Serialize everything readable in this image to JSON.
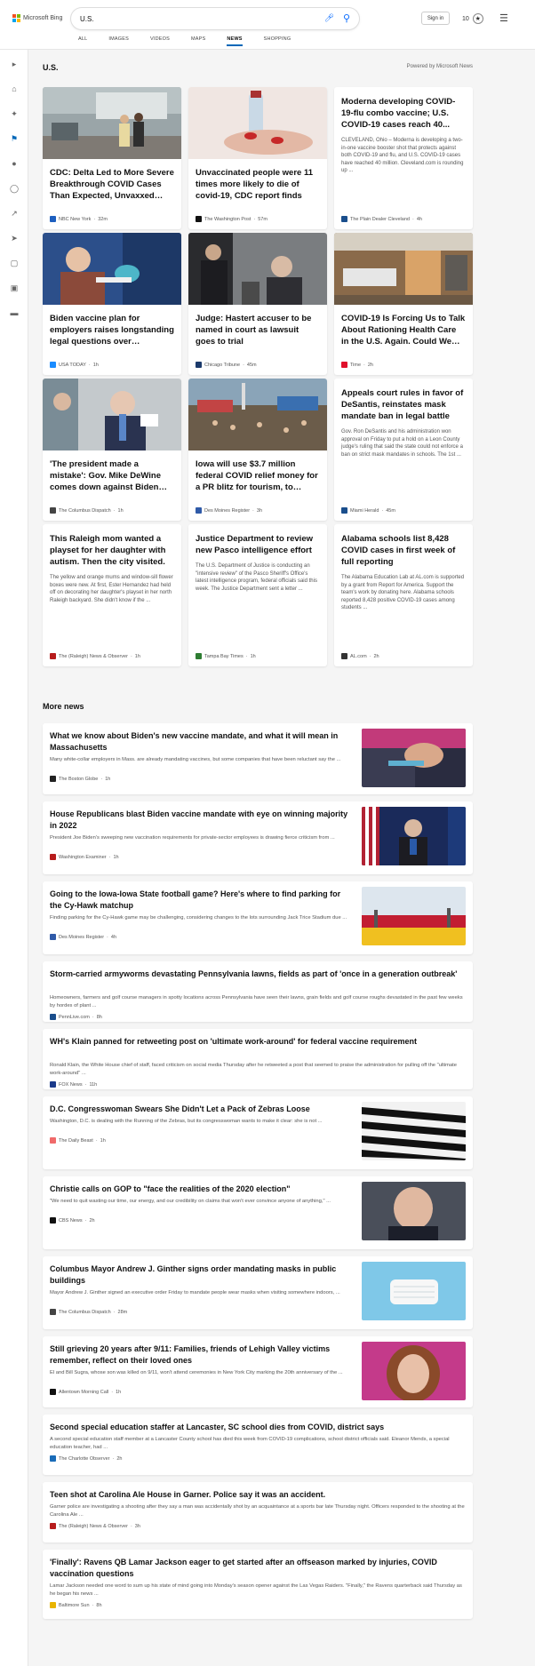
{
  "header": {
    "brand": "Microsoft Bing",
    "search_value": "U.S.",
    "signin": "Sign in",
    "reward_count": "10",
    "tabs": [
      {
        "label": "ALL"
      },
      {
        "label": "IMAGES"
      },
      {
        "label": "VIDEOS"
      },
      {
        "label": "MAPS"
      },
      {
        "label": "NEWS"
      },
      {
        "label": "SHOPPING"
      }
    ]
  },
  "section": {
    "title": "U.S.",
    "powered": "Powered by Microsoft News"
  },
  "cards": [
    {
      "title": "CDC: Delta Led to More Severe Breakthrough COVID Cases Than Expected, Unvaxxed Still...",
      "snippet": "",
      "source": "NBC New York",
      "time": "32m",
      "src_color": "#1d5fbf",
      "img": "street"
    },
    {
      "title": "Unvaccinated people were 11 times more likely to die of covid-19, CDC report finds",
      "snippet": "",
      "source": "The Washington Post",
      "time": "57m",
      "src_color": "#111111",
      "img": "vial"
    },
    {
      "title": "Moderna developing COVID-19-flu combo vaccine; U.S. COVID-19 cases reach 40...",
      "snippet": "CLEVELAND, Ohio – Moderna is developing a two-in-one vaccine booster shot that protects against both COVID-19 and flu, and U.S. COVID-19 cases have reached 40 million. Cleveland.com is rounding up ...",
      "source": "The Plain Dealer Cleveland",
      "time": "4h",
      "src_color": "#1a4e8c",
      "img": ""
    },
    {
      "title": "Biden vaccine plan for employers raises longstanding legal questions over mandate...",
      "snippet": "",
      "source": "USA TODAY",
      "time": "1h",
      "src_color": "#1a8cff",
      "img": "nurse"
    },
    {
      "title": "Judge: Hastert accuser to be named in court as lawsuit goes to trial",
      "snippet": "",
      "source": "Chicago Tribune",
      "time": "45m",
      "src_color": "#1b3a6b",
      "img": "court"
    },
    {
      "title": "COVID-19 Is Forcing Us to Talk About Rationing Health Care in the U.S. Again. Could We Hav...",
      "snippet": "",
      "source": "Time",
      "time": "2h",
      "src_color": "#e0102b",
      "img": "hospital"
    },
    {
      "title": "'The president made a mistake': Gov. Mike DeWine comes down against Biden vaccine order",
      "snippet": "",
      "source": "The Columbus Dispatch",
      "time": "1h",
      "src_color": "#444444",
      "img": "dewine"
    },
    {
      "title": "Iowa will use $3.7 million federal COVID relief money for a PR blitz for tourism, to recru...",
      "snippet": "",
      "source": "Des Moines Register",
      "time": "3h",
      "src_color": "#2f5aa8",
      "img": "fair"
    },
    {
      "title": "Appeals court rules in favor of DeSantis, reinstates mask mandate ban in legal battle",
      "snippet": "Gov. Ron DeSantis and his administration won approval on Friday to put a hold on a Leon County judge's ruling that said the state could not enforce a ban on strict mask mandates in schools. The 1st ...",
      "source": "Miami Herald",
      "time": "45m",
      "src_color": "#1a4e8c",
      "img": ""
    },
    {
      "title": "This Raleigh mom wanted a playset for her daughter with autism. Then the city visited.",
      "snippet": "The yellow and orange mums and window-sill flower boxes were new. At first, Ester Hernandez had held off on decorating her daughter's playset in her north Raleigh backyard. She didn't know if the ...",
      "source": "The (Raleigh) News & Observer",
      "time": "1h",
      "src_color": "#b71c1c",
      "img": ""
    },
    {
      "title": "Justice Department to review new Pasco intelligence effort",
      "snippet": "The U.S. Department of Justice is conducting an \"intensive review\" of the Pasco Sheriff's Office's latest intelligence program, federal officials said this week. The Justice Department sent a letter ...",
      "source": "Tampa Bay Times",
      "time": "1h",
      "src_color": "#2e7d32",
      "img": ""
    },
    {
      "title": "Alabama schools list 8,428 COVID cases in first week of full reporting",
      "snippet": "The Alabama Education Lab at AL.com is supported by a grant from Report for America. Support the team's work by donating here. Alabama schools reported 8,428 positive COVID-19 cases among students ...",
      "source": "AL.com",
      "time": "2h",
      "src_color": "#333333",
      "img": ""
    }
  ],
  "more": {
    "title": "More news",
    "items": [
      {
        "title": "What we know about Biden's new vaccine mandate, and what it will mean in Massachusetts",
        "snippet": "Many white-collar employers in Mass. are already mandating vaccines, but some companies that have been reluctant say the ...",
        "source": "The Boston Globe",
        "time": "1h",
        "src_color": "#222222",
        "img": "vaccine"
      },
      {
        "title": "House Republicans blast Biden vaccine mandate with eye on winning majority in 2022",
        "snippet": "President Joe Biden's sweeping new vaccination requirements for private-sector employees is drawing fierce criticism from ...",
        "source": "Washington Examiner",
        "time": "1h",
        "src_color": "#b71c1c",
        "img": "podium"
      },
      {
        "title": "Going to the Iowa-Iowa State football game? Here's where to find parking for the Cy-Hawk matchup",
        "snippet": "Finding parking for the Cy-Hawk game may be challenging, considering changes to the lots surrounding Jack Trice Stadium due ...",
        "source": "Des Moines Register",
        "time": "4h",
        "src_color": "#2f5aa8",
        "img": "stadium"
      },
      {
        "title": "Storm-carried armyworms devastating Pennsylvania lawns, fields as part of 'once in a generation outbreak'",
        "snippet": "Homeowners, farmers and golf course managers in spotty locations across Pennsylvania have seen their lawns, grain fields and golf course roughs devastated in the past few weeks by hordes of plant ...",
        "source": "PennLive.com",
        "time": "8h",
        "src_color": "#1a4e8c",
        "img": ""
      },
      {
        "title": "WH's Klain panned for retweeting post on 'ultimate work-around' for federal vaccine requirement",
        "snippet": "Ronald Klain, the White House chief of staff, faced criticism on social media Thursday after he retweeted a post that seemed to praise the administration for pulling off the \"ultimate work-around\" ...",
        "source": "FOX News",
        "time": "11h",
        "src_color": "#1a3a8a",
        "img": ""
      },
      {
        "title": "D.C. Congresswoman Swears She Didn't Let a Pack of Zebras Loose",
        "snippet": "Washington, D.C. is dealing with the Running of the Zebras, but its congresswoman wants to make it clear: she is not ...",
        "source": "The Daily Beast",
        "time": "1h",
        "src_color": "#f06a6a",
        "img": "zebra"
      },
      {
        "title": "Christie calls on GOP to \"face the realities of the 2020 election\"",
        "snippet": "\"We need to quit wasting our time, our energy, and our credibility on claims that won't ever convince anyone of anything,\" ...",
        "source": "CBS News",
        "time": "2h",
        "src_color": "#111111",
        "img": "christie"
      },
      {
        "title": "Columbus Mayor Andrew J. Ginther signs order mandating masks in public buildings",
        "snippet": "Mayor Andrew J. Ginther signed an executive order Friday to mandate people wear masks when visiting somewhere indoors, ...",
        "source": "The Columbus Dispatch",
        "time": "28m",
        "src_color": "#444444",
        "img": "mask"
      },
      {
        "title": "Still grieving 20 years after 9/11: Families, friends of Lehigh Valley victims remember, reflect on their loved ones",
        "snippet": "El and Bill Sugra, whose son was killed on 9/11, won't attend ceremonies in New York City marking the 20th anniversary of the ...",
        "source": "Allentown Morning Call",
        "time": "1h",
        "src_color": "#111111",
        "img": "woman"
      },
      {
        "title": "Second special education staffer at Lancaster, SC school dies from COVID, district says",
        "snippet": "A second special education staff member at a Lancaster County school has died this week from COVID-19 complications, school district officials said. Eleanor Mends, a special education teacher, had ...",
        "source": "The Charlotte Observer",
        "time": "2h",
        "src_color": "#1a6cb8",
        "img": ""
      },
      {
        "title": "Teen shot at Carolina Ale House in Garner. Police say it was an accident.",
        "snippet": "Garner police are investigating a shooting after they say a man was accidentally shot by an acquaintance at a sports bar late Thursday night. Officers responded to the shooting at the Carolina Ale ...",
        "source": "The (Raleigh) News & Observer",
        "time": "3h",
        "src_color": "#b71c1c",
        "img": ""
      },
      {
        "title": "'Finally': Ravens QB Lamar Jackson eager to get started after an offseason marked by injuries, COVID vaccination questions",
        "snippet": "Lamar Jackson needed one word to sum up his state of mind going into Monday's season opener against the Las Vegas Raiders. \"Finally,\" the Ravens quarterback said Thursday as he began his news ...",
        "source": "Baltimore Sun",
        "time": "8h",
        "src_color": "#e8b400",
        "img": ""
      }
    ]
  }
}
